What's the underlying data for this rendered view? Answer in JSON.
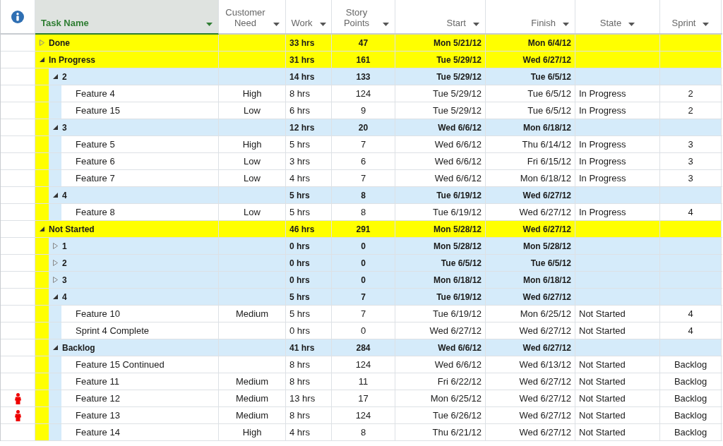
{
  "columns": [
    {
      "label": "Task Name",
      "selected": true
    },
    {
      "label": "Customer Need",
      "selected": false
    },
    {
      "label": "Work",
      "selected": false
    },
    {
      "label": "Story Points",
      "selected": false
    },
    {
      "label": "Start",
      "selected": false
    },
    {
      "label": "Finish",
      "selected": false
    },
    {
      "label": "State",
      "selected": false
    },
    {
      "label": "Sprint",
      "selected": false
    }
  ],
  "rows": [
    {
      "name": "Done",
      "expanded": false,
      "work": "33 hrs",
      "story_points": "47",
      "start": "Mon 5/21/12",
      "finish": "Mon 6/4/12"
    },
    {
      "name": "In Progress",
      "expanded": true,
      "work": "31 hrs",
      "story_points": "161",
      "start": "Tue 5/29/12",
      "finish": "Wed 6/27/12",
      "children": [
        {
          "name": "2",
          "expanded": true,
          "work": "14 hrs",
          "story_points": "133",
          "start": "Tue 5/29/12",
          "finish": "Tue 6/5/12",
          "children": [
            {
              "name": "Feature 4",
              "overallocated": false,
              "customer_need": "High",
              "work": "8 hrs",
              "story_points": "124",
              "start": "Tue 5/29/12",
              "finish": "Tue 6/5/12",
              "state": "In Progress",
              "sprint": "2"
            },
            {
              "name": "Feature 15",
              "overallocated": false,
              "customer_need": "Low",
              "work": "6 hrs",
              "story_points": "9",
              "start": "Tue 5/29/12",
              "finish": "Tue 6/5/12",
              "state": "In Progress",
              "sprint": "2"
            }
          ]
        },
        {
          "name": "3",
          "expanded": true,
          "work": "12 hrs",
          "story_points": "20",
          "start": "Wed 6/6/12",
          "finish": "Mon 6/18/12",
          "children": [
            {
              "name": "Feature 5",
              "overallocated": false,
              "customer_need": "High",
              "work": "5 hrs",
              "story_points": "7",
              "start": "Wed 6/6/12",
              "finish": "Thu 6/14/12",
              "state": "In Progress",
              "sprint": "3"
            },
            {
              "name": "Feature 6",
              "overallocated": false,
              "customer_need": "Low",
              "work": "3 hrs",
              "story_points": "6",
              "start": "Wed 6/6/12",
              "finish": "Fri 6/15/12",
              "state": "In Progress",
              "sprint": "3"
            },
            {
              "name": "Feature 7",
              "overallocated": false,
              "customer_need": "Low",
              "work": "4 hrs",
              "story_points": "7",
              "start": "Wed 6/6/12",
              "finish": "Mon 6/18/12",
              "state": "In Progress",
              "sprint": "3"
            }
          ]
        },
        {
          "name": "4",
          "expanded": true,
          "work": "5 hrs",
          "story_points": "8",
          "start": "Tue 6/19/12",
          "finish": "Wed 6/27/12",
          "children": [
            {
              "name": "Feature 8",
              "overallocated": false,
              "customer_need": "Low",
              "work": "5 hrs",
              "story_points": "8",
              "start": "Tue 6/19/12",
              "finish": "Wed 6/27/12",
              "state": "In Progress",
              "sprint": "4"
            }
          ]
        }
      ]
    },
    {
      "name": "Not Started",
      "expanded": true,
      "work": "46 hrs",
      "story_points": "291",
      "start": "Mon 5/28/12",
      "finish": "Wed 6/27/12",
      "children": [
        {
          "name": "1",
          "expanded": false,
          "work": "0 hrs",
          "story_points": "0",
          "start": "Mon 5/28/12",
          "finish": "Mon 5/28/12"
        },
        {
          "name": "2",
          "expanded": false,
          "work": "0 hrs",
          "story_points": "0",
          "start": "Tue 6/5/12",
          "finish": "Tue 6/5/12"
        },
        {
          "name": "3",
          "expanded": false,
          "work": "0 hrs",
          "story_points": "0",
          "start": "Mon 6/18/12",
          "finish": "Mon 6/18/12"
        },
        {
          "name": "4",
          "expanded": true,
          "work": "5 hrs",
          "story_points": "7",
          "start": "Tue 6/19/12",
          "finish": "Wed 6/27/12",
          "children": [
            {
              "name": "Feature 10",
              "overallocated": false,
              "customer_need": "Medium",
              "work": "5 hrs",
              "story_points": "7",
              "start": "Tue 6/19/12",
              "finish": "Mon 6/25/12",
              "state": "Not Started",
              "sprint": "4"
            },
            {
              "name": "Sprint 4 Complete",
              "overallocated": false,
              "work": "0 hrs",
              "story_points": "0",
              "start": "Wed 6/27/12",
              "finish": "Wed 6/27/12",
              "state": "Not Started",
              "sprint": "4"
            }
          ]
        },
        {
          "name": "Backlog",
          "expanded": true,
          "work": "41 hrs",
          "story_points": "284",
          "start": "Wed 6/6/12",
          "finish": "Wed 6/27/12",
          "children": [
            {
              "name": "Feature 15 Continued",
              "overallocated": false,
              "work": "8 hrs",
              "story_points": "124",
              "start": "Wed 6/6/12",
              "finish": "Wed 6/13/12",
              "state": "Not Started",
              "sprint": "Backlog"
            },
            {
              "name": "Feature 11",
              "overallocated": false,
              "customer_need": "Medium",
              "work": "8 hrs",
              "story_points": "11",
              "start": "Fri 6/22/12",
              "finish": "Wed 6/27/12",
              "state": "Not Started",
              "sprint": "Backlog"
            },
            {
              "name": "Feature 12",
              "overallocated": true,
              "customer_need": "Medium",
              "work": "13 hrs",
              "story_points": "17",
              "start": "Mon 6/25/12",
              "finish": "Wed 6/27/12",
              "state": "Not Started",
              "sprint": "Backlog"
            },
            {
              "name": "Feature 13",
              "overallocated": true,
              "customer_need": "Medium",
              "work": "8 hrs",
              "story_points": "124",
              "start": "Tue 6/26/12",
              "finish": "Wed 6/27/12",
              "state": "Not Started",
              "sprint": "Backlog"
            },
            {
              "name": "Feature 14",
              "overallocated": false,
              "customer_need": "High",
              "work": "4 hrs",
              "story_points": "8",
              "start": "Thu 6/21/12",
              "finish": "Wed 6/27/12",
              "state": "Not Started",
              "sprint": "Backlog"
            }
          ]
        }
      ]
    }
  ]
}
